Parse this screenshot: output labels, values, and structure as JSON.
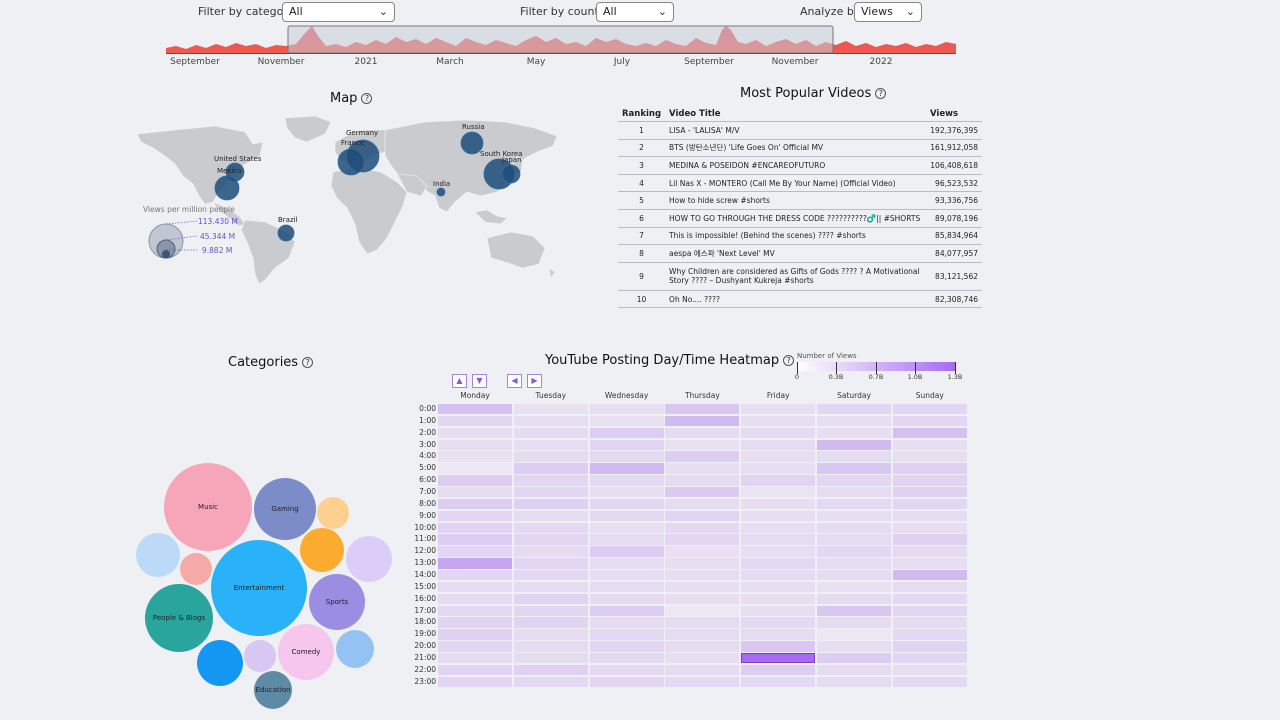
{
  "filters": {
    "category": {
      "label": "Filter by category:",
      "value": "All"
    },
    "country": {
      "label": "Filter by country:",
      "value": "All"
    },
    "analyze": {
      "label": "Analyze by:",
      "value": "Views"
    }
  },
  "timeline": {
    "ticks": [
      "September",
      "November",
      "2021",
      "March",
      "May",
      "July",
      "September",
      "November",
      "2022"
    ]
  },
  "map": {
    "title": "Map",
    "countries": [
      "United States",
      "Mexico",
      "Germany",
      "France",
      "Russia",
      "South Korea",
      "Japan",
      "India",
      "Brazil"
    ],
    "legend_title": "Views per million people",
    "legend_values": [
      "113.430 M",
      "45.344 M",
      "9.882 M"
    ]
  },
  "popular": {
    "title": "Most Popular Videos",
    "headers": [
      "Ranking",
      "Video Title",
      "Views"
    ],
    "rows": [
      {
        "rank": "1",
        "title": "LISA - 'LALISA' M/V",
        "views": "192,376,395"
      },
      {
        "rank": "2",
        "title": "BTS (방탄소년단) 'Life Goes On' Official MV",
        "views": "161,912,058"
      },
      {
        "rank": "3",
        "title": "MEDINA & POSEIDON #ENCAREOFUTURO",
        "views": "106,408,618"
      },
      {
        "rank": "4",
        "title": "Lil Nas X - MONTERO (Call Me By Your Name) (Official Video)",
        "views": "96,523,532"
      },
      {
        "rank": "5",
        "title": "How to hide screw #shorts",
        "views": "93,336,756"
      },
      {
        "rank": "6",
        "title": "HOW TO GO THROUGH THE DRESS CODE ??????????♂️|| #SHORTS",
        "views": "89,078,196"
      },
      {
        "rank": "7",
        "title": "This is impossible! (Behind the scenes) ???? #shorts",
        "views": "85,834,964"
      },
      {
        "rank": "8",
        "title": "aespa 에스파 'Next Level' MV",
        "views": "84,077,957"
      },
      {
        "rank": "9",
        "title": "Why Children are considered as Gifts of Gods ???? ? A Motivational Story ???? – Dushyant Kukreja #shorts",
        "views": "83,121,562"
      },
      {
        "rank": "10",
        "title": "Oh No.... ????",
        "views": "82,308,746"
      }
    ]
  },
  "categories": {
    "title": "Categories",
    "labels": [
      "Music",
      "Gaming",
      "Entertainment",
      "Sports",
      "People & Blogs",
      "Comedy",
      "Education"
    ]
  },
  "heatmap": {
    "title": "YouTube Posting Day/Time Heatmap",
    "legend_title": "Number of Views",
    "legend_ticks": [
      "0",
      "0.3B",
      "0.7B",
      "1.0B",
      "1.3B"
    ],
    "days": [
      "Monday",
      "Tuesday",
      "Wednesday",
      "Thursday",
      "Friday",
      "Saturday",
      "Sunday"
    ],
    "hours": [
      "0:00",
      "1:00",
      "2:00",
      "3:00",
      "4:00",
      "5:00",
      "6:00",
      "7:00",
      "8:00",
      "9:00",
      "10:00",
      "11:00",
      "12:00",
      "13:00",
      "14:00",
      "15:00",
      "16:00",
      "17:00",
      "18:00",
      "19:00",
      "20:00",
      "21:00",
      "22:00",
      "23:00"
    ],
    "values": [
      [
        0.35,
        0.1,
        0.12,
        0.3,
        0.12,
        0.18,
        0.18
      ],
      [
        0.18,
        0.12,
        0.1,
        0.4,
        0.12,
        0.12,
        0.18
      ],
      [
        0.12,
        0.14,
        0.25,
        0.14,
        0.14,
        0.12,
        0.35
      ],
      [
        0.12,
        0.12,
        0.2,
        0.1,
        0.14,
        0.4,
        0.12
      ],
      [
        0.1,
        0.14,
        0.16,
        0.25,
        0.12,
        0.14,
        0.12
      ],
      [
        0.05,
        0.25,
        0.4,
        0.12,
        0.12,
        0.3,
        0.22
      ],
      [
        0.25,
        0.18,
        0.16,
        0.14,
        0.2,
        0.18,
        0.2
      ],
      [
        0.14,
        0.18,
        0.12,
        0.28,
        0.08,
        0.14,
        0.22
      ],
      [
        0.25,
        0.22,
        0.18,
        0.14,
        0.12,
        0.16,
        0.18
      ],
      [
        0.18,
        0.14,
        0.16,
        0.2,
        0.12,
        0.12,
        0.14
      ],
      [
        0.2,
        0.16,
        0.12,
        0.16,
        0.12,
        0.14,
        0.12
      ],
      [
        0.25,
        0.18,
        0.14,
        0.18,
        0.14,
        0.14,
        0.22
      ],
      [
        0.18,
        0.14,
        0.25,
        0.1,
        0.12,
        0.16,
        0.14
      ],
      [
        0.55,
        0.18,
        0.14,
        0.12,
        0.16,
        0.14,
        0.12
      ],
      [
        0.18,
        0.16,
        0.12,
        0.12,
        0.14,
        0.14,
        0.4
      ],
      [
        0.14,
        0.14,
        0.14,
        0.12,
        0.12,
        0.1,
        0.14
      ],
      [
        0.14,
        0.2,
        0.14,
        0.12,
        0.12,
        0.14,
        0.16
      ],
      [
        0.16,
        0.18,
        0.25,
        0.05,
        0.12,
        0.3,
        0.18
      ],
      [
        0.2,
        0.2,
        0.14,
        0.14,
        0.16,
        0.14,
        0.14
      ],
      [
        0.22,
        0.14,
        0.16,
        0.14,
        0.14,
        0.05,
        0.16
      ],
      [
        0.18,
        0.14,
        0.18,
        0.14,
        0.3,
        0.12,
        0.2
      ],
      [
        0.14,
        0.14,
        0.16,
        0.12,
        1.0,
        0.25,
        0.18
      ],
      [
        0.2,
        0.22,
        0.16,
        0.14,
        0.25,
        0.14,
        0.12
      ],
      [
        0.18,
        0.16,
        0.18,
        0.16,
        0.16,
        0.14,
        0.16
      ]
    ]
  }
}
